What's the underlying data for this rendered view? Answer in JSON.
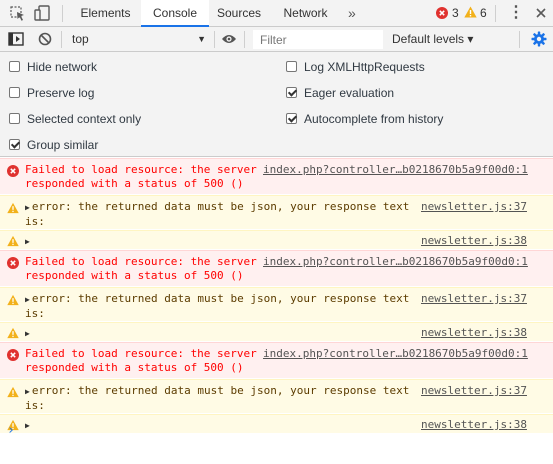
{
  "tabbar": {
    "tabs": [
      {
        "label": "Elements"
      },
      {
        "label": "Console"
      },
      {
        "label": "Sources"
      },
      {
        "label": "Network"
      }
    ],
    "more_label": "»",
    "error_count": "3",
    "warning_count": "6",
    "menu_label": "⋮"
  },
  "toolbar": {
    "context_value": "top",
    "filter_placeholder": "Filter",
    "levels_label": "Default levels ▾"
  },
  "settings": {
    "left": [
      {
        "label": "Hide network",
        "checked": false
      },
      {
        "label": "Preserve log",
        "checked": false
      },
      {
        "label": "Selected context only",
        "checked": false
      },
      {
        "label": "Group similar",
        "checked": true
      }
    ],
    "right": [
      {
        "label": "Log XMLHttpRequests",
        "checked": false
      },
      {
        "label": "Eager evaluation",
        "checked": true
      },
      {
        "label": "Autocomplete from history",
        "checked": true
      }
    ]
  },
  "messages": [
    {
      "type": "error",
      "line1": "Failed to load resource: the server",
      "line2": "responded with a status of 500 ()",
      "source": "index.php?controller…b0218670b5a9f00d0:1"
    },
    {
      "type": "warning",
      "line1": "error: the returned data must be json, your response text",
      "line2": "is:",
      "source": "newsletter.js:37"
    },
    {
      "type": "warning",
      "line1": "",
      "line2": "",
      "source": "newsletter.js:38"
    },
    {
      "type": "error",
      "line1": "Failed to load resource: the server",
      "line2": "responded with a status of 500 ()",
      "source": "index.php?controller…b0218670b5a9f00d0:1"
    },
    {
      "type": "warning",
      "line1": "error: the returned data must be json, your response text",
      "line2": "is:",
      "source": "newsletter.js:37"
    },
    {
      "type": "warning",
      "line1": "",
      "line2": "",
      "source": "newsletter.js:38"
    },
    {
      "type": "error",
      "line1": "Failed to load resource: the server",
      "line2": "responded with a status of 500 ()",
      "source": "index.php?controller…b0218670b5a9f00d0:1"
    },
    {
      "type": "warning",
      "line1": "error: the returned data must be json, your response text",
      "line2": "is:",
      "source": "newsletter.js:37"
    },
    {
      "type": "warning",
      "line1": "",
      "line2": "",
      "source": "newsletter.js:38"
    }
  ],
  "prompt_symbol": "›",
  "colors": {
    "accent": "#1a73e8",
    "error_bg": "#fff0f0",
    "error_text": "#ff0000",
    "warning_bg": "#fffbe5",
    "warning_text": "#5c3c00",
    "error_icon": "#e0322f",
    "warning_icon": "#f2b11b"
  },
  "icons": [
    "inspect-element-icon",
    "device-toolbar-icon",
    "error-icon",
    "warning-icon",
    "kebab-menu-icon",
    "sidebar-toggle-icon",
    "clear-console-icon",
    "eye-icon",
    "gear-icon"
  ]
}
